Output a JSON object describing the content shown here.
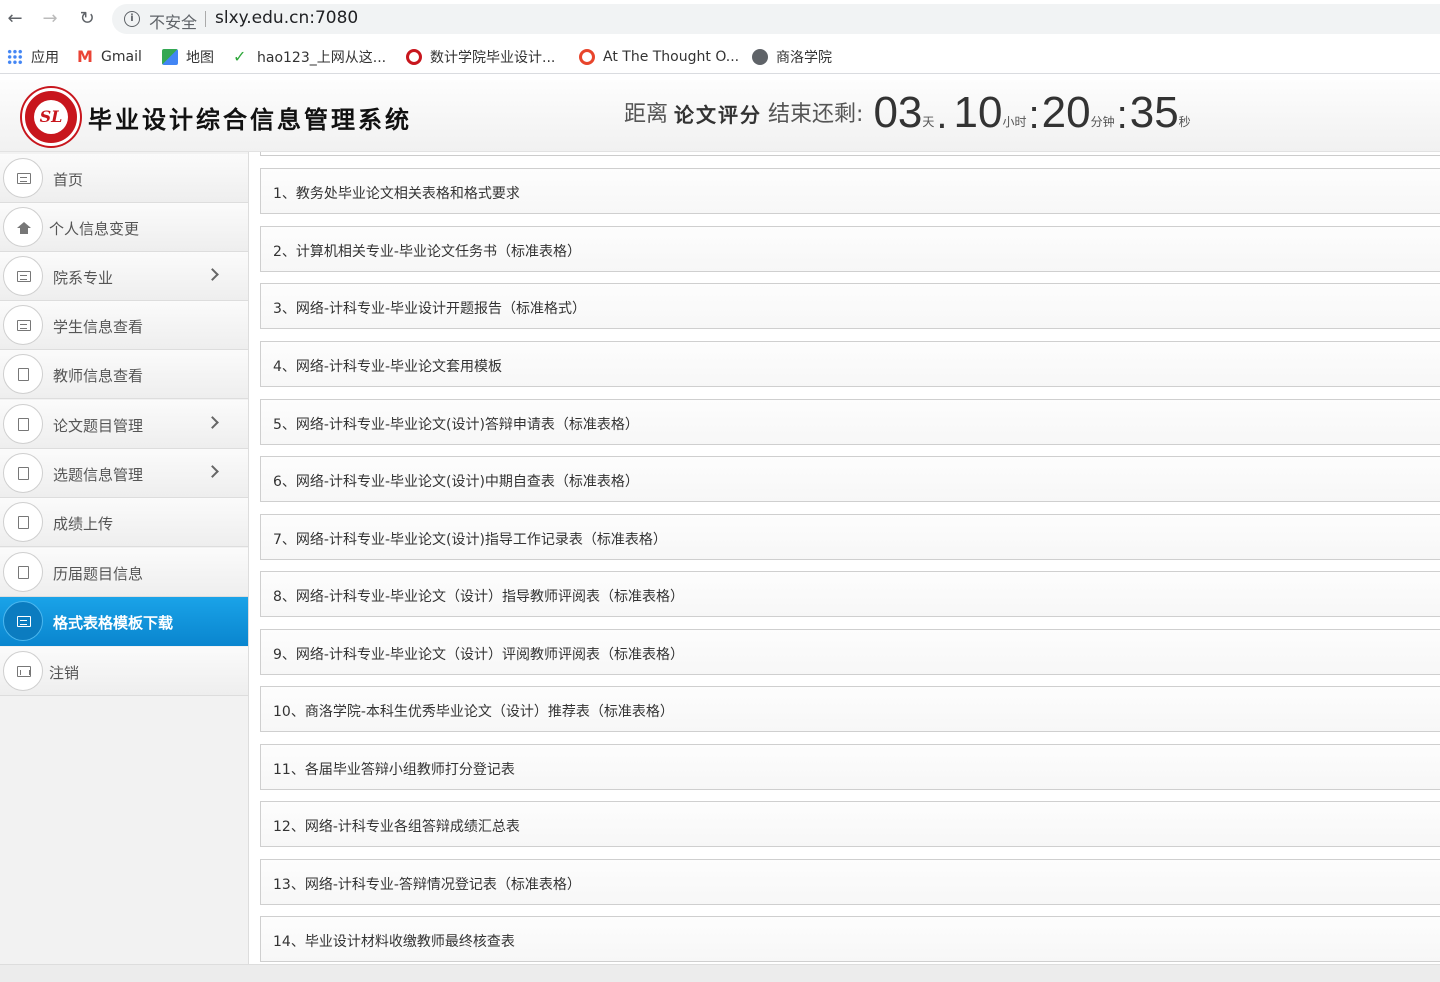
{
  "browser": {
    "insecure_label": "不安全",
    "url": "slxy.edu.cn:7080",
    "bookmarks": [
      {
        "label": "应用",
        "icon": "apps-grid-icon",
        "color": "#4285f4"
      },
      {
        "label": "Gmail",
        "icon": "gmail-icon",
        "color": "#ea4335"
      },
      {
        "label": "地图",
        "icon": "maps-icon",
        "color": "#34a853"
      },
      {
        "label": "hao123_上网从这...",
        "icon": "hao123-icon",
        "color": "#2fa83b"
      },
      {
        "label": "数计学院毕业设计...",
        "icon": "college-logo-icon",
        "color": "#c8161d"
      },
      {
        "label": "At The Thought O...",
        "icon": "quote-icon",
        "color": "#e8452c"
      },
      {
        "label": "商洛学院",
        "icon": "globe-icon",
        "color": "#5f6368"
      }
    ]
  },
  "header": {
    "logo_letters": "SL",
    "system_title": "毕业设计综合信息管理系统",
    "countdown": {
      "prefix": "距离",
      "phase": "论文评分",
      "suffix": "结束还剩:",
      "days": "03",
      "days_unit": "天",
      "hours": "10",
      "hours_unit": "小时",
      "minutes": "20",
      "minutes_unit": "分钟",
      "seconds": "35",
      "seconds_unit": "秒",
      "dot": ".",
      "colon": ":"
    }
  },
  "sidebar": {
    "items": [
      {
        "label": "首页",
        "icon": "list-icon",
        "active": false,
        "has_submenu": false
      },
      {
        "label": "个人信息变更",
        "icon": "home-icon",
        "active": false,
        "has_submenu": false
      },
      {
        "label": "院系专业",
        "icon": "list-icon",
        "active": false,
        "has_submenu": true
      },
      {
        "label": "学生信息查看",
        "icon": "list-icon",
        "active": false,
        "has_submenu": false
      },
      {
        "label": "教师信息查看",
        "icon": "file-icon",
        "active": false,
        "has_submenu": false
      },
      {
        "label": "论文题目管理",
        "icon": "file-icon",
        "active": false,
        "has_submenu": true
      },
      {
        "label": "选题信息管理",
        "icon": "file-icon",
        "active": false,
        "has_submenu": true
      },
      {
        "label": "成绩上传",
        "icon": "file-icon",
        "active": false,
        "has_submenu": false
      },
      {
        "label": "历届题目信息",
        "icon": "file-icon",
        "active": false,
        "has_submenu": false
      },
      {
        "label": "格式表格模板下载",
        "icon": "list-icon",
        "active": true,
        "has_submenu": false
      },
      {
        "label": "注销",
        "icon": "chart-icon",
        "active": false,
        "has_submenu": false
      }
    ],
    "active_color": "#1296dd"
  },
  "documents": [
    "1、教务处毕业论文相关表格和格式要求",
    "2、计算机相关专业-毕业论文任务书（标准表格）",
    "3、网络-计科专业-毕业设计开题报告（标准格式）",
    "4、网络-计科专业-毕业论文套用模板",
    "5、网络-计科专业-毕业论文(设计)答辩申请表（标准表格）",
    "6、网络-计科专业-毕业论文(设计)中期自查表（标准表格）",
    "7、网络-计科专业-毕业论文(设计)指导工作记录表（标准表格）",
    "8、网络-计科专业-毕业论文（设计）指导教师评阅表（标准表格）",
    "9、网络-计科专业-毕业论文（设计）评阅教师评阅表（标准表格）",
    "10、商洛学院-本科生优秀毕业论文（设计）推荐表（标准表格）",
    "11、各届毕业答辩小组教师打分登记表",
    "12、网络-计科专业各组答辩成绩汇总表",
    "13、网络-计科专业-答辩情况登记表（标准表格）",
    "14、毕业设计材料收缴教师最终核查表"
  ]
}
